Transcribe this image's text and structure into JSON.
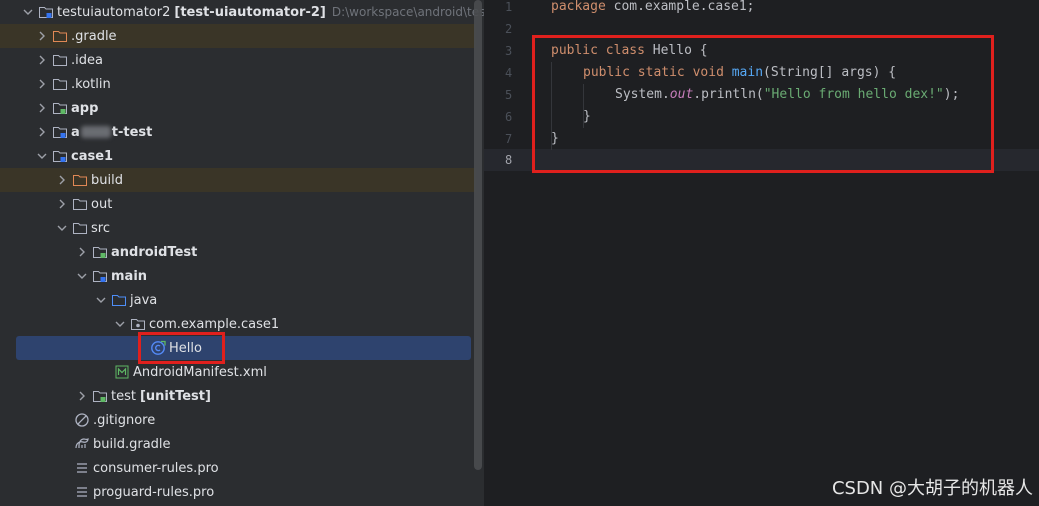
{
  "project_tree": {
    "rows": [
      {
        "label": "testuiautomator2",
        "bold_suffix": "[test-uiautomator-2]",
        "hint": "D:\\workspace\\android\\testuiauto",
        "icon": "module-folder-icon"
      },
      {
        "label": ".gradle",
        "icon": "folder-excluded-icon"
      },
      {
        "label": ".idea",
        "icon": "folder-icon"
      },
      {
        "label": ".kotlin",
        "icon": "folder-icon"
      },
      {
        "label": "app",
        "icon": "module-folder-icon"
      },
      {
        "label_prefix": "a",
        "label_suffix": "t-test",
        "icon": "module-folder-icon"
      },
      {
        "label": "case1",
        "icon": "module-folder-icon"
      },
      {
        "label": "build",
        "icon": "folder-excluded-icon"
      },
      {
        "label": "out",
        "icon": "folder-icon"
      },
      {
        "label": "src",
        "icon": "folder-icon"
      },
      {
        "label": "androidTest",
        "icon": "test-source-folder-icon"
      },
      {
        "label": "main",
        "icon": "module-folder-icon"
      },
      {
        "label": "java",
        "icon": "source-folder-icon"
      },
      {
        "label": "com.example.case1",
        "icon": "package-icon"
      },
      {
        "label": "Hello",
        "icon": "java-class-icon"
      },
      {
        "label": "AndroidManifest.xml",
        "icon": "manifest-icon"
      },
      {
        "label": "test",
        "bold_suffix": "[unitTest]",
        "icon": "test-source-folder-icon"
      },
      {
        "label": ".gitignore",
        "icon": "gitignore-icon"
      },
      {
        "label": "build.gradle",
        "icon": "gradle-icon"
      },
      {
        "label": "consumer-rules.pro",
        "icon": "text-file-icon"
      },
      {
        "label": "proguard-rules.pro",
        "icon": "text-file-icon"
      }
    ]
  },
  "editor": {
    "line_numbers": [
      "1",
      "2",
      "3",
      "4",
      "5",
      "6",
      "7",
      "8"
    ],
    "current_line": "8",
    "lines": {
      "l1": {
        "kw": "package",
        "rest": " com.example.case1;"
      },
      "l3": {
        "kw1": "public",
        "kw2": "class",
        "rest": " Hello {"
      },
      "l4": {
        "kw1": "public",
        "kw2": "static",
        "kw3": "void",
        "fn": "main",
        "rest": "(String[] args) {"
      },
      "l5": {
        "a": "System.",
        "field": "out",
        "b": ".println(",
        "str": "\"Hello from hello dex!\"",
        "c": ");"
      },
      "l6": {
        "text": "}"
      },
      "l7": {
        "text": "}"
      }
    }
  },
  "watermark": "CSDN @大胡子的机器人",
  "colors": {
    "highlight_box": "#e0201d",
    "selection": "#2e436e",
    "keyword": "#cf8e6d",
    "function": "#56a8f5",
    "string": "#6aab73",
    "static_field": "#c77dbb"
  }
}
